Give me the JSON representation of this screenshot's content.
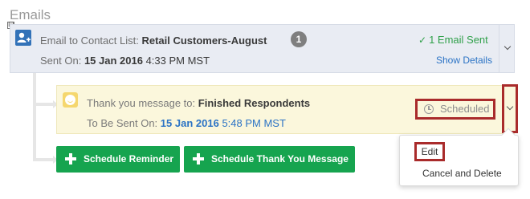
{
  "section": {
    "title": "Emails",
    "collapse_symbol": "⊟"
  },
  "main_card": {
    "icon": "add-contact-icon",
    "email_prefix": "Email to Contact List:",
    "list_name": "Retail Customers-August",
    "count": "1",
    "sent_prefix": "Sent On:",
    "sent_date": "15 Jan 2016",
    "sent_time": "4:33 PM MST",
    "status_check": "✓",
    "status_text": "1 Email Sent",
    "show_details": "Show Details"
  },
  "thanks_card": {
    "icon": "smiley-icon",
    "message_prefix": "Thank you message to:",
    "recipients": "Finished Respondents",
    "to_be_sent_prefix": "To Be Sent On:",
    "send_date": "15 Jan 2016",
    "send_time": "5:48 PM MST",
    "status": "Scheduled"
  },
  "buttons": {
    "reminder": "Schedule Reminder",
    "thank_you": "Schedule Thank You Message"
  },
  "dropdown": {
    "edit": "Edit",
    "cancel_delete": "Cancel and Delete"
  },
  "colors": {
    "accent_blue": "#2b73c5",
    "success_green": "#16a44f",
    "highlight_red": "#a92b2b",
    "scheduled_bg": "#fbf7dc"
  }
}
